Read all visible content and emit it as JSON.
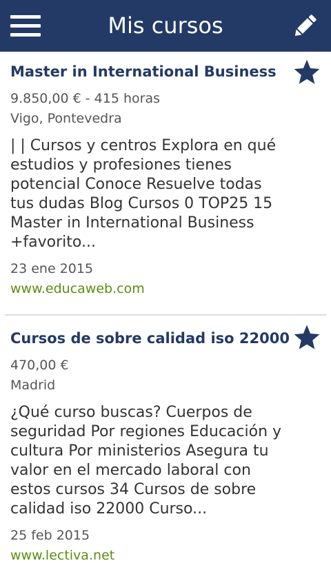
{
  "header": {
    "title": "Mis cursos",
    "menu_icon": "hamburger-menu-icon",
    "edit_icon": "pencil-icon",
    "background": "#233a66"
  },
  "courses": [
    {
      "title": "Master in International Business",
      "price_hours": "9.850,00 € - 415 horas",
      "location": "Vigo, Pontevedra",
      "snippet": "| | Cursos y centros Explora en qué estudios y profesiones tienes potencial Conoce Resuelve todas tus dudas Blog Cursos 0 TOP25 15 Master in International Business +favorito...",
      "date": "23 ene 2015",
      "url": "www.educaweb.com",
      "favorite": true
    },
    {
      "title": "Cursos de sobre calidad iso 22000",
      "price_hours": "470,00 €",
      "location": "Madrid",
      "snippet": "¿Qué curso buscas? Cuerpos de seguridad Por regiones Educación y cultura Por ministerios Asegura tu valor en el mercado laboral con estos cursos 34 Cursos de sobre calidad iso 22000 Curso...",
      "date": "25 feb 2015",
      "url": "www.lectiva.net",
      "favorite": true
    }
  ],
  "colors": {
    "title": "#233a66",
    "url": "#5b8e10",
    "star": "#233a66"
  }
}
